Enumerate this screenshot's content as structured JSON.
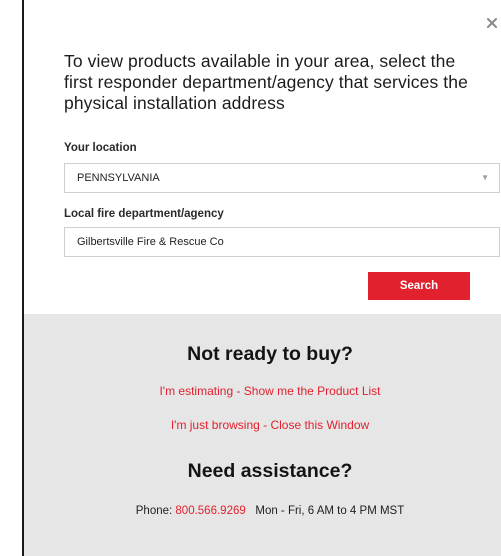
{
  "modal": {
    "close_label": "×",
    "heading": "To view products available in your area, select the first responder department/agency that services the physical installation address"
  },
  "form": {
    "location_label": "Your location",
    "location_value": "PENNSYLVANIA",
    "department_label": "Local fire department/agency",
    "department_value": "Gilbertsville Fire & Rescue Co",
    "search_label": "Search"
  },
  "panel": {
    "not_ready_title": "Not ready to buy?",
    "estimating_link": "I'm estimating - Show me the Product List",
    "browsing_link": "I'm just browsing - Close this Window",
    "assistance_title": "Need assistance?",
    "phone_label": "Phone:",
    "phone_number": "800.566.9269",
    "hours": "Mon - Fri, 6 AM to 4 PM MST"
  },
  "icons": {
    "close": "close-icon",
    "dropdown": "chevron-down-icon"
  },
  "colors": {
    "accent": "#e1222e",
    "panel_background": "#e6e6e6",
    "text": "#1c1c1c"
  }
}
